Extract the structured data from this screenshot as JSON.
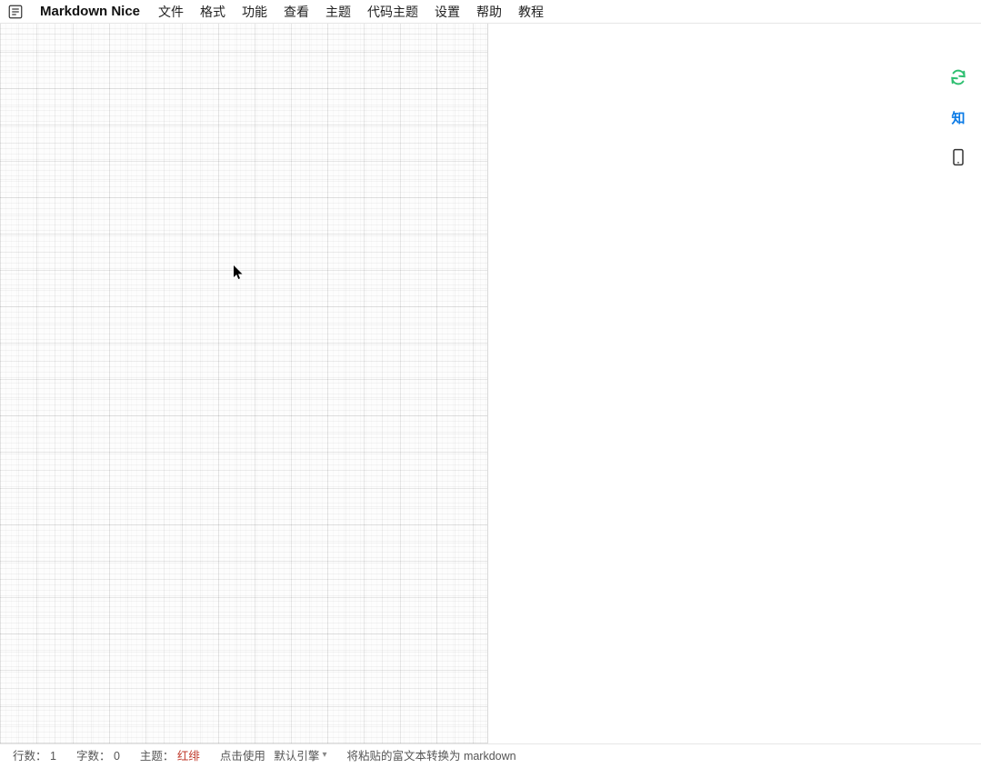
{
  "app_title": "Markdown Nice",
  "menu": {
    "file": "文件",
    "format": "格式",
    "function": "功能",
    "view": "查看",
    "theme": "主题",
    "code_theme": "代码主题",
    "settings": "设置",
    "help": "帮助",
    "tutorial": "教程"
  },
  "right_toolbar": {
    "sync_icon": "sync-icon",
    "zhihu_label": "知",
    "mobile_icon": "mobile-icon"
  },
  "statusbar": {
    "lines_label": "行数：",
    "lines_value": "1",
    "words_label": "字数：",
    "words_value": "0",
    "theme_label": "主题：",
    "theme_value": "红绯",
    "engine_prefix": "点击使用",
    "engine_selected": "默认引擎",
    "hint": "将粘贴的富文本转换为 markdown"
  }
}
